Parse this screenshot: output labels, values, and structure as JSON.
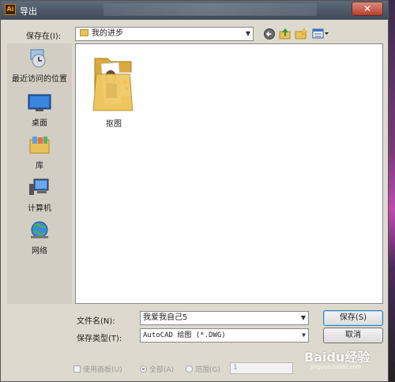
{
  "window": {
    "title": "导出",
    "app_icon": "Ai",
    "close_label": "✕"
  },
  "save_in": {
    "label": "保存在(I):",
    "folder": "我的进步"
  },
  "toolbar": {
    "icons": [
      "back-icon",
      "up-folder-icon",
      "new-folder-icon",
      "view-menu-icon"
    ]
  },
  "sidebar": {
    "items": [
      {
        "label": "最近访问的位置",
        "icon": "recent-places-icon"
      },
      {
        "label": "桌面",
        "icon": "desktop-icon"
      },
      {
        "label": "库",
        "icon": "libraries-icon"
      },
      {
        "label": "计算机",
        "icon": "computer-icon"
      },
      {
        "label": "网络",
        "icon": "network-icon"
      }
    ]
  },
  "files": [
    {
      "name": "抠图",
      "icon": "folder-icon"
    }
  ],
  "filename": {
    "label": "文件名(N):",
    "value": "我爱我自己5"
  },
  "filetype": {
    "label": "保存类型(T):",
    "value": "AutoCAD 绘图 (*.DWG)"
  },
  "buttons": {
    "save": "保存(S)",
    "cancel": "取消"
  },
  "options": {
    "use_artboards": "使用画板(U)",
    "all": "全部(A)",
    "range": "范围(G)",
    "range_value": "1"
  },
  "watermark": {
    "text": "Baidu经验",
    "sub": "jingyan.baidu.com"
  },
  "colors": {
    "titlebar": "#4a5664",
    "dialog": "#ddd9ce",
    "close": "#c0463a",
    "accent": "#3c7fb1"
  }
}
